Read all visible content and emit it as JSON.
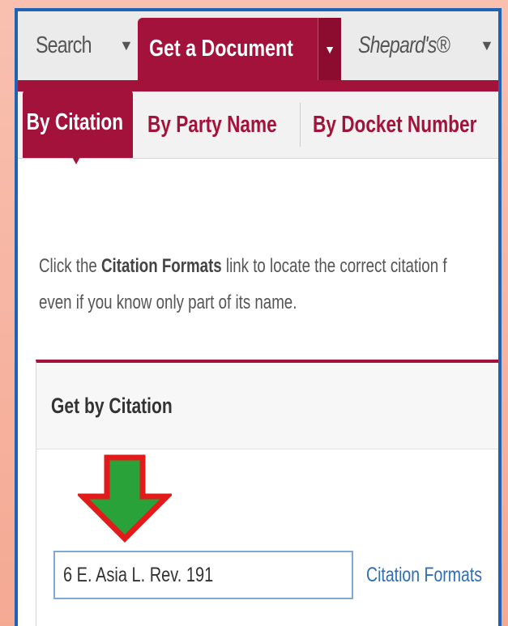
{
  "nav": {
    "search_label": "Search",
    "search_arrow": "▼",
    "get_document_label": "Get a Document",
    "get_document_arrow": "▼",
    "shepards_label": "Shepard's®",
    "shepards_arrow": "▼"
  },
  "tabs": [
    {
      "label": "By Citation",
      "active": true
    },
    {
      "label": "By Party Name",
      "active": false
    },
    {
      "label": "By Docket Number",
      "active": false
    }
  ],
  "instructions": {
    "line1_prefix": "Click the ",
    "line1_bold": "Citation Formats",
    "line1_suffix": " link to locate the correct citation f",
    "line2": "even if you know only part of its name."
  },
  "panel": {
    "title": "Get by Citation"
  },
  "citation_input": {
    "value": "6 E. Asia L. Rev. 191"
  },
  "citation_formats_link": "Citation Formats",
  "colors": {
    "brand": "#a3123a",
    "frame": "#1e62b5",
    "arrow_fill": "#2aa23a",
    "arrow_stroke": "#e21a1a",
    "link": "#2f6db5"
  },
  "icons": {
    "down_arrow": "green-down-arrow-icon"
  }
}
